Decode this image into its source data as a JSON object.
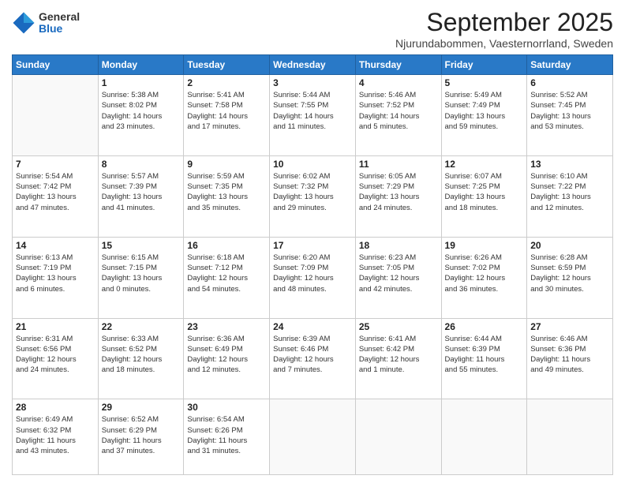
{
  "logo": {
    "general": "General",
    "blue": "Blue"
  },
  "title": "September 2025",
  "subtitle": "Njurundabommen, Vaesternorrland, Sweden",
  "days_header": [
    "Sunday",
    "Monday",
    "Tuesday",
    "Wednesday",
    "Thursday",
    "Friday",
    "Saturday"
  ],
  "weeks": [
    [
      {
        "day": "",
        "info": ""
      },
      {
        "day": "1",
        "info": "Sunrise: 5:38 AM\nSunset: 8:02 PM\nDaylight: 14 hours\nand 23 minutes."
      },
      {
        "day": "2",
        "info": "Sunrise: 5:41 AM\nSunset: 7:58 PM\nDaylight: 14 hours\nand 17 minutes."
      },
      {
        "day": "3",
        "info": "Sunrise: 5:44 AM\nSunset: 7:55 PM\nDaylight: 14 hours\nand 11 minutes."
      },
      {
        "day": "4",
        "info": "Sunrise: 5:46 AM\nSunset: 7:52 PM\nDaylight: 14 hours\nand 5 minutes."
      },
      {
        "day": "5",
        "info": "Sunrise: 5:49 AM\nSunset: 7:49 PM\nDaylight: 13 hours\nand 59 minutes."
      },
      {
        "day": "6",
        "info": "Sunrise: 5:52 AM\nSunset: 7:45 PM\nDaylight: 13 hours\nand 53 minutes."
      }
    ],
    [
      {
        "day": "7",
        "info": "Sunrise: 5:54 AM\nSunset: 7:42 PM\nDaylight: 13 hours\nand 47 minutes."
      },
      {
        "day": "8",
        "info": "Sunrise: 5:57 AM\nSunset: 7:39 PM\nDaylight: 13 hours\nand 41 minutes."
      },
      {
        "day": "9",
        "info": "Sunrise: 5:59 AM\nSunset: 7:35 PM\nDaylight: 13 hours\nand 35 minutes."
      },
      {
        "day": "10",
        "info": "Sunrise: 6:02 AM\nSunset: 7:32 PM\nDaylight: 13 hours\nand 29 minutes."
      },
      {
        "day": "11",
        "info": "Sunrise: 6:05 AM\nSunset: 7:29 PM\nDaylight: 13 hours\nand 24 minutes."
      },
      {
        "day": "12",
        "info": "Sunrise: 6:07 AM\nSunset: 7:25 PM\nDaylight: 13 hours\nand 18 minutes."
      },
      {
        "day": "13",
        "info": "Sunrise: 6:10 AM\nSunset: 7:22 PM\nDaylight: 13 hours\nand 12 minutes."
      }
    ],
    [
      {
        "day": "14",
        "info": "Sunrise: 6:13 AM\nSunset: 7:19 PM\nDaylight: 13 hours\nand 6 minutes."
      },
      {
        "day": "15",
        "info": "Sunrise: 6:15 AM\nSunset: 7:15 PM\nDaylight: 13 hours\nand 0 minutes."
      },
      {
        "day": "16",
        "info": "Sunrise: 6:18 AM\nSunset: 7:12 PM\nDaylight: 12 hours\nand 54 minutes."
      },
      {
        "day": "17",
        "info": "Sunrise: 6:20 AM\nSunset: 7:09 PM\nDaylight: 12 hours\nand 48 minutes."
      },
      {
        "day": "18",
        "info": "Sunrise: 6:23 AM\nSunset: 7:05 PM\nDaylight: 12 hours\nand 42 minutes."
      },
      {
        "day": "19",
        "info": "Sunrise: 6:26 AM\nSunset: 7:02 PM\nDaylight: 12 hours\nand 36 minutes."
      },
      {
        "day": "20",
        "info": "Sunrise: 6:28 AM\nSunset: 6:59 PM\nDaylight: 12 hours\nand 30 minutes."
      }
    ],
    [
      {
        "day": "21",
        "info": "Sunrise: 6:31 AM\nSunset: 6:56 PM\nDaylight: 12 hours\nand 24 minutes."
      },
      {
        "day": "22",
        "info": "Sunrise: 6:33 AM\nSunset: 6:52 PM\nDaylight: 12 hours\nand 18 minutes."
      },
      {
        "day": "23",
        "info": "Sunrise: 6:36 AM\nSunset: 6:49 PM\nDaylight: 12 hours\nand 12 minutes."
      },
      {
        "day": "24",
        "info": "Sunrise: 6:39 AM\nSunset: 6:46 PM\nDaylight: 12 hours\nand 7 minutes."
      },
      {
        "day": "25",
        "info": "Sunrise: 6:41 AM\nSunset: 6:42 PM\nDaylight: 12 hours\nand 1 minute."
      },
      {
        "day": "26",
        "info": "Sunrise: 6:44 AM\nSunset: 6:39 PM\nDaylight: 11 hours\nand 55 minutes."
      },
      {
        "day": "27",
        "info": "Sunrise: 6:46 AM\nSunset: 6:36 PM\nDaylight: 11 hours\nand 49 minutes."
      }
    ],
    [
      {
        "day": "28",
        "info": "Sunrise: 6:49 AM\nSunset: 6:32 PM\nDaylight: 11 hours\nand 43 minutes."
      },
      {
        "day": "29",
        "info": "Sunrise: 6:52 AM\nSunset: 6:29 PM\nDaylight: 11 hours\nand 37 minutes."
      },
      {
        "day": "30",
        "info": "Sunrise: 6:54 AM\nSunset: 6:26 PM\nDaylight: 11 hours\nand 31 minutes."
      },
      {
        "day": "",
        "info": ""
      },
      {
        "day": "",
        "info": ""
      },
      {
        "day": "",
        "info": ""
      },
      {
        "day": "",
        "info": ""
      }
    ]
  ]
}
